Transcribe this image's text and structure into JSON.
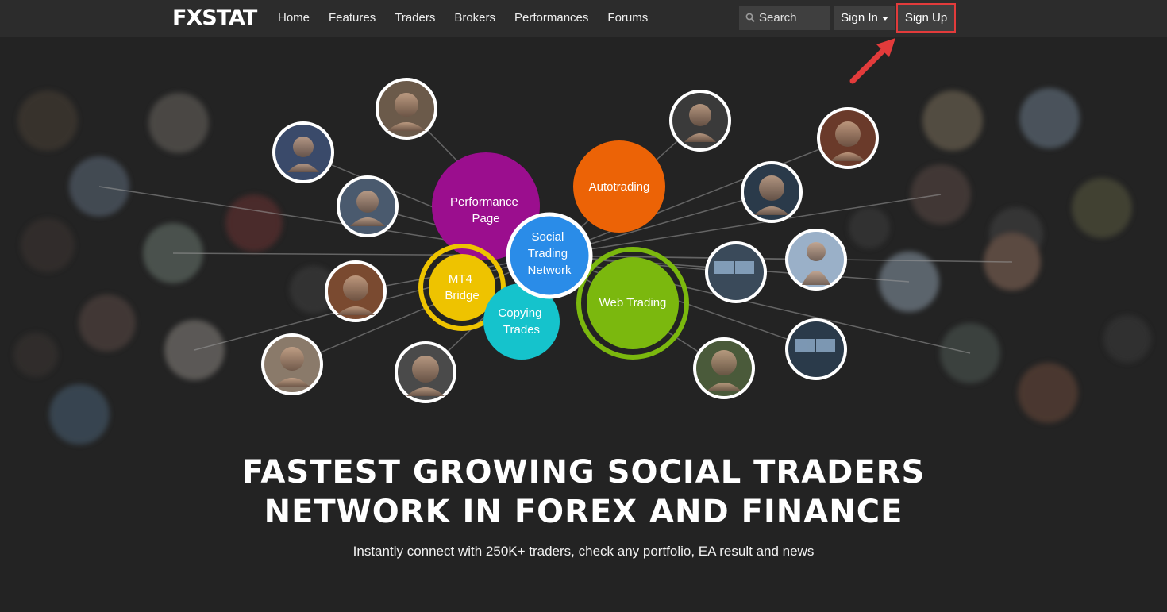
{
  "header": {
    "logo": "FXSTAT",
    "nav": [
      "Home",
      "Features",
      "Traders",
      "Brokers",
      "Performances",
      "Forums"
    ],
    "search_placeholder": "Search",
    "signin_label": "Sign In",
    "signup_label": "Sign Up"
  },
  "hero": {
    "bubbles": {
      "performance": "Performance\nPage",
      "autotrading": "Autotrading",
      "social": "Social\nTrading\nNetwork",
      "mt4": "MT4\nBridge",
      "copying": "Copying\nTrades",
      "web": "Web Trading"
    },
    "headline_line1": "FASTEST GROWING SOCIAL TRADERS",
    "headline_line2": "NETWORK IN FOREX AND FINANCE",
    "subtitle": "Instantly connect with 250K+ traders, check any portfolio, EA result and news"
  },
  "colors": {
    "background": "#232323",
    "topbar": "#2c2c2c",
    "performance": "#9b0e8e",
    "autotrading": "#ec6306",
    "social": "#2a8ce8",
    "mt4": "#eec300",
    "copying": "#15c3cc",
    "web": "#7bb80e",
    "signup_highlight": "#e23b3b"
  }
}
